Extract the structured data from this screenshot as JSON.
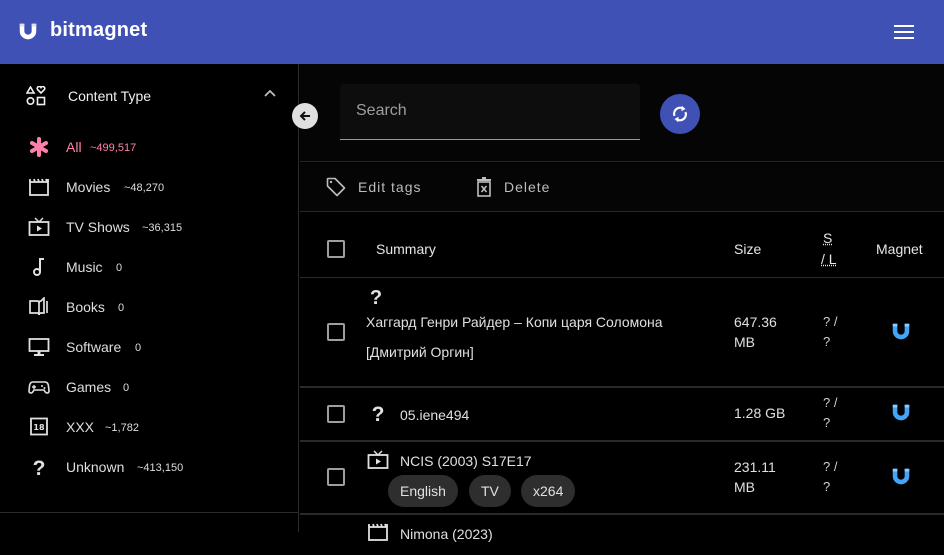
{
  "app": {
    "title": "bitmagnet",
    "brand_color": "#3f51b5",
    "accent_color": "#ff80ab",
    "magnet_color": "#42a5f5"
  },
  "sidebar": {
    "section_title": "Content Type",
    "items": [
      {
        "label": "All",
        "count": "~499,517",
        "icon": "asterisk-icon",
        "active": true
      },
      {
        "label": "Movies",
        "count": "~48,270",
        "icon": "movie-clapper-icon"
      },
      {
        "label": "TV Shows",
        "count": "~36,315",
        "icon": "tv-icon"
      },
      {
        "label": "Music",
        "count": "0",
        "icon": "music-note-icon"
      },
      {
        "label": "Books",
        "count": "0",
        "icon": "book-icon"
      },
      {
        "label": "Software",
        "count": "0",
        "icon": "monitor-icon"
      },
      {
        "label": "Games",
        "count": "0",
        "icon": "gamepad-icon"
      },
      {
        "label": "XXX",
        "count": "~1,782",
        "icon": "adult-18-icon"
      },
      {
        "label": "Unknown",
        "count": "~413,150",
        "icon": "question-mark-icon"
      }
    ]
  },
  "search": {
    "placeholder": "Search",
    "value": ""
  },
  "actions": {
    "edit_tags": "Edit tags",
    "delete": "Delete"
  },
  "table": {
    "columns": {
      "summary": "Summary",
      "size": "Size",
      "seeders_abbr": "S",
      "leechers_abbr": "/ L",
      "magnet": "Magnet"
    },
    "rows": [
      {
        "icon": "question-mark-icon",
        "title_line1": "Хаггард Генри Райдер – Копи царя Соломона",
        "title_line2": "[Дмитрий Оргин]",
        "size_line1": "647.36",
        "size_line2": "MB",
        "sl_line1": "? /",
        "sl_line2": "?",
        "tags": []
      },
      {
        "icon": "question-mark-icon",
        "title_line1": "05.iene494",
        "size_line1": "1.28 GB",
        "sl_line1": "? /",
        "sl_line2": "?",
        "tags": []
      },
      {
        "icon": "tv-icon",
        "title_line1": "NCIS (2003) S17E17",
        "size_line1": "231.11",
        "size_line2": "MB",
        "sl_line1": "? /",
        "sl_line2": "?",
        "tags": [
          "English",
          "TV",
          "x264"
        ]
      },
      {
        "icon": "movie-clapper-icon",
        "title_line1": "Nimona (2023)"
      }
    ]
  }
}
